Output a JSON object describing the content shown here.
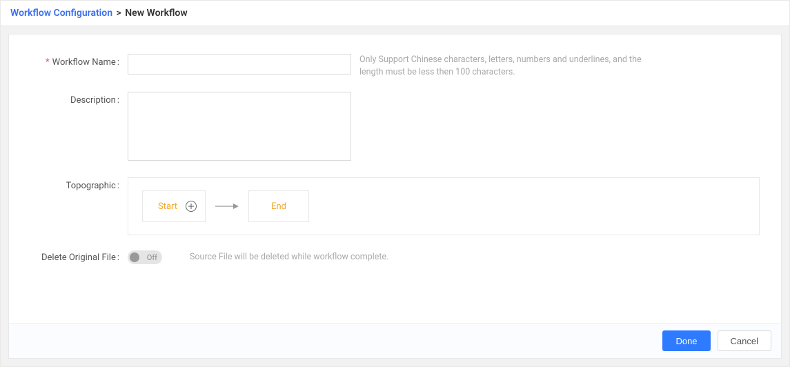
{
  "breadcrumb": {
    "root": "Workflow Configuration",
    "separator": ">",
    "current": "New Workflow"
  },
  "form": {
    "workflow_name": {
      "label": "Workflow Name",
      "required_mark": "*",
      "colon": ":",
      "value": "",
      "hint": "Only Support Chinese characters, letters, numbers and underlines, and the length must be less then 100 characters."
    },
    "description": {
      "label": "Description",
      "colon": ":",
      "value": ""
    },
    "topographic": {
      "label": "Topographic",
      "colon": ":",
      "start_node": "Start",
      "end_node": "End"
    },
    "delete_original": {
      "label": "Delete Original File",
      "colon": ":",
      "toggle_state_text": "Off",
      "hint": "Source File will be deleted while workflow complete."
    }
  },
  "footer": {
    "done": "Done",
    "cancel": "Cancel"
  }
}
